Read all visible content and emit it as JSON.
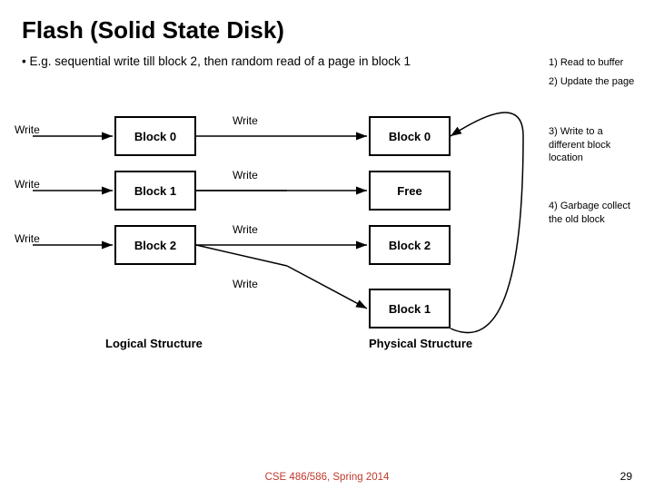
{
  "title": "Flash (Solid State Disk)",
  "bullet": "• E.g. sequential write till block 2, then random read of a page in block 1",
  "annotations": {
    "a1": "1) Read to buffer",
    "a2": "2) Update the page",
    "a3": "3) Write to a different block location",
    "a4": "4) Garbage collect the old block"
  },
  "logical_blocks": [
    {
      "label": "Block 0"
    },
    {
      "label": "Block 1"
    },
    {
      "label": "Block 2"
    }
  ],
  "physical_blocks": [
    {
      "label": "Block 0"
    },
    {
      "label": "Free"
    },
    {
      "label": "Block 2"
    },
    {
      "label": "Block 1"
    }
  ],
  "write_labels": [
    "Write",
    "Write",
    "Write"
  ],
  "write_labels_right": [
    "Write",
    "Write",
    "Write",
    "Write"
  ],
  "logical_structure_label": "Logical Structure",
  "physical_structure_label": "Physical Structure",
  "footer": {
    "course": "CSE 486/586, Spring 2014",
    "page": "29"
  }
}
